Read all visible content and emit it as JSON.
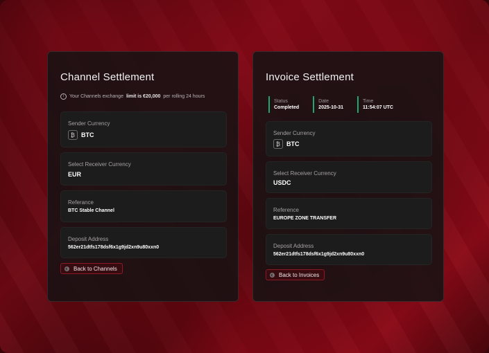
{
  "channel": {
    "title": "Channel Settlement",
    "note_prefix": "Your Channels exchange",
    "note_bold": "limit is €20,000",
    "note_suffix": "per rolling 24 hours",
    "sender_label": "Sender Currency",
    "sender_value": "BTC",
    "receiver_label": "Select Receiver Currency",
    "receiver_value": "EUR",
    "reference_label": "Referance",
    "reference_value": "BTC Stable Channel",
    "deposit_label": "Deposit Address",
    "deposit_value": "562er21dtfs178dsf6x1g9jd2xn9u80xxn0",
    "back_label": "Back to Channels"
  },
  "invoice": {
    "title": "Invoice Settlement",
    "status": [
      {
        "label": "Status",
        "value": "Completed"
      },
      {
        "label": "Date",
        "value": "2025-10-31"
      },
      {
        "label": "Time",
        "value": "11:54:07 UTC"
      }
    ],
    "sender_label": "Sender Currency",
    "sender_value": "BTC",
    "receiver_label": "Select Receiver Currency",
    "receiver_value": "USDC",
    "reference_label": "Reference",
    "reference_value": "EUROPE ZONE TRANSFER",
    "deposit_label": "Deposit Address",
    "deposit_value": "562er21dtfs178dsf6x1g9jd2xn9u80xxn0",
    "back_label": "Back to Invoices"
  },
  "icons": {
    "coin": "bitcoin-icon",
    "info": "info-icon",
    "back": "arrow-left-icon"
  },
  "colors": {
    "accent": "#8c1a26",
    "status_bar": "#1fa870"
  }
}
